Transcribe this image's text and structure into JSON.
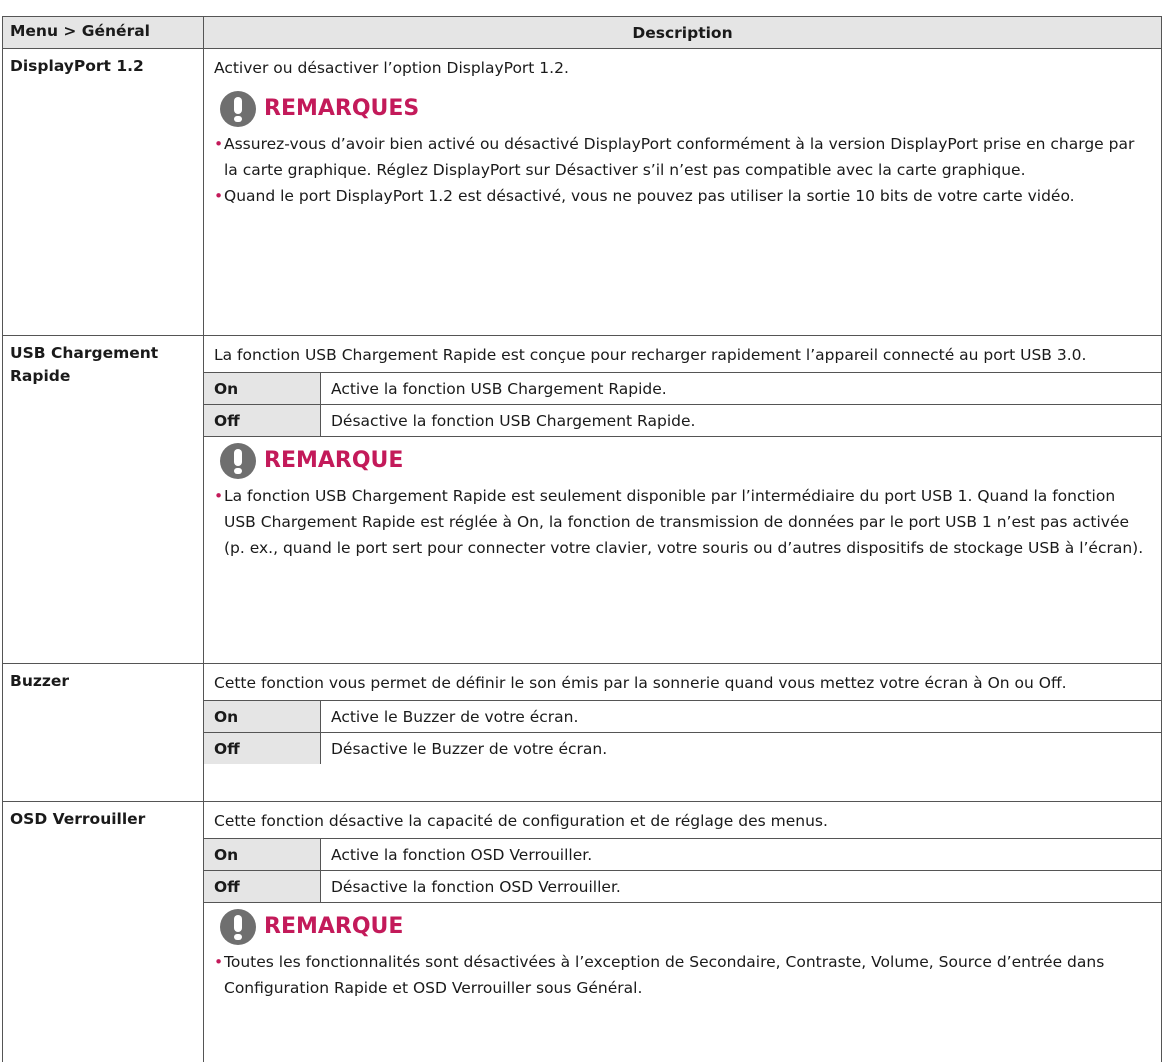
{
  "header": {
    "col1": "Menu > Général",
    "col2": "Description"
  },
  "rows": [
    {
      "label": "DisplayPort 1.2",
      "desc": "Activer ou désactiver l’option DisplayPort 1.2.",
      "note": {
        "title": "REMARQUES",
        "bullets": [
          "Assurez-vous d’avoir bien activé ou désactivé DisplayPort conformément à la version DisplayPort prise en charge par la carte graphique. Réglez DisplayPort sur Désactiver s’il n’est pas compatible avec la carte graphique.",
          "Quand le port DisplayPort 1.2 est désactivé, vous ne pouvez pas utiliser la sortie 10 bits de votre carte vidéo."
        ]
      }
    },
    {
      "label": "USB Chargement Rapide",
      "desc": "La fonction USB Chargement Rapide est conçue pour recharger rapidement l’appareil connecté au port USB 3.0.",
      "options": [
        {
          "key": "On",
          "value": "Active la fonction USB Chargement Rapide."
        },
        {
          "key": "Off",
          "value": "Désactive la fonction USB Chargement Rapide."
        }
      ],
      "note": {
        "title": "REMARQUE",
        "bullets": [
          "La fonction USB Chargement Rapide est seulement disponible par l’intermédiaire du port USB 1. Quand la fonction USB Chargement Rapide est réglée à On, la fonction de transmission de données par le port USB 1 n’est pas activée (p. ex., quand le port sert pour connecter votre clavier, votre souris ou d’autres dispositifs de stockage USB à l’écran)."
        ]
      }
    },
    {
      "label": "Buzzer",
      "desc": "Cette fonction vous permet de définir le son émis par la sonnerie quand vous mettez votre écran à On ou Off.",
      "options": [
        {
          "key": "On",
          "value": "Active le Buzzer de votre écran."
        },
        {
          "key": "Off",
          "value": "Désactive le Buzzer de votre écran."
        }
      ]
    },
    {
      "label": "OSD Verrouiller",
      "desc": "Cette fonction désactive la capacité de configuration et de réglage des menus.",
      "options": [
        {
          "key": "On",
          "value": "Active la fonction OSD Verrouiller."
        },
        {
          "key": "Off",
          "value": "Désactive la fonction OSD Verrouiller."
        }
      ],
      "note": {
        "title": "REMARQUE",
        "bullets": [
          "Toutes les fonctionnalités sont désactivées à l’exception de Secondaire, Contraste, Volume, Source d’entrée dans Configuration Rapide et OSD Verrouiller sous Général."
        ]
      }
    }
  ]
}
